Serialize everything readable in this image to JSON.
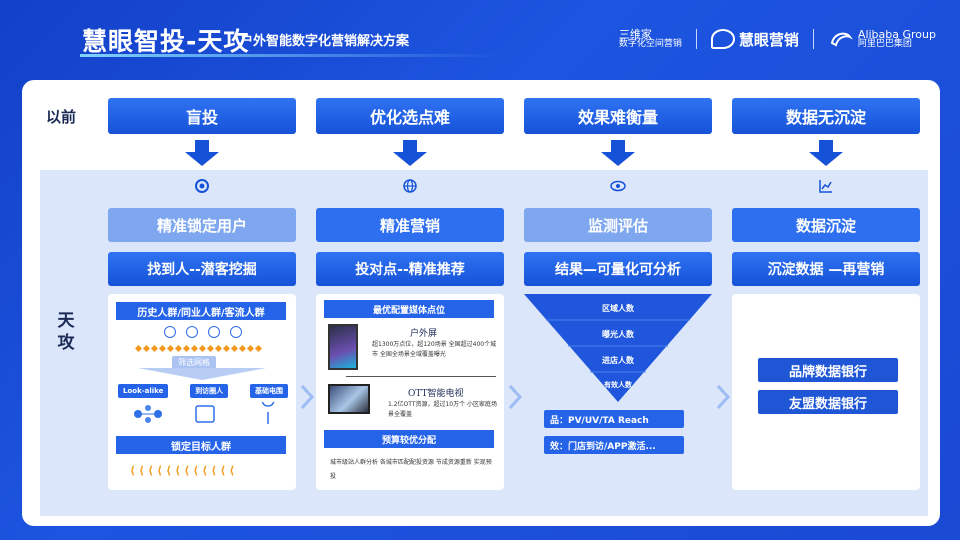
{
  "header": {
    "title": "慧眼智投-天攻",
    "subtitle": "户外智能数字化营销解决方案",
    "logos": [
      {
        "name": "三维家",
        "sub": "数字化空间营销"
      },
      {
        "name": "慧眼营销"
      },
      {
        "name": "Alibaba Group",
        "sub": "阿里巴巴集团"
      }
    ]
  },
  "before": {
    "label": "以前",
    "items": [
      "盲投",
      "优化选点难",
      "效果难衡量",
      "数据无沉淀"
    ]
  },
  "after": {
    "label": "天攻",
    "columns": [
      {
        "icon": "target-icon",
        "title": "精准锁定用户",
        "subtitle": "找到人--潜客挖掘",
        "detail": {
          "head": "历史人群/同业人群/客流人群",
          "tag": "筛选网格",
          "chips": [
            "Look-alike",
            "到访圈人",
            "基础电围"
          ],
          "target": "锁定目标人群"
        }
      },
      {
        "icon": "globe-icon",
        "title": "精准营销",
        "subtitle": "投对点--精准推荐",
        "detail": {
          "head": "最优配置媒体点位",
          "outdoor_title": "户外屏",
          "outdoor_desc": "超1300万点位，超120场景 全国超过400个城市 全国全场景全域覆盖曝光",
          "ott_title": "OTT智能电视",
          "ott_desc": "1.2亿OTT资源，超过10万个 小区家庭场景全覆盖",
          "budget": "预算较优分配",
          "foot": "城市级站人群分析 各城市匹配配投资源 节成资源重新 实现预投"
        }
      },
      {
        "icon": "eye-icon",
        "title": "监测评估",
        "subtitle": "结果—可量化可分析",
        "detail": {
          "funnel": [
            "区域人数",
            "曝光人数",
            "进店人数",
            "有效人数"
          ],
          "boxes": [
            "品：PV/UV/TA Reach",
            "效：门店到访/APP激活..."
          ]
        }
      },
      {
        "icon": "chart-icon",
        "title": "数据沉淀",
        "subtitle": "沉淀数据 —再营销",
        "detail": {
          "boxes": [
            "品牌数据银行",
            "友盟数据银行"
          ]
        }
      }
    ]
  }
}
